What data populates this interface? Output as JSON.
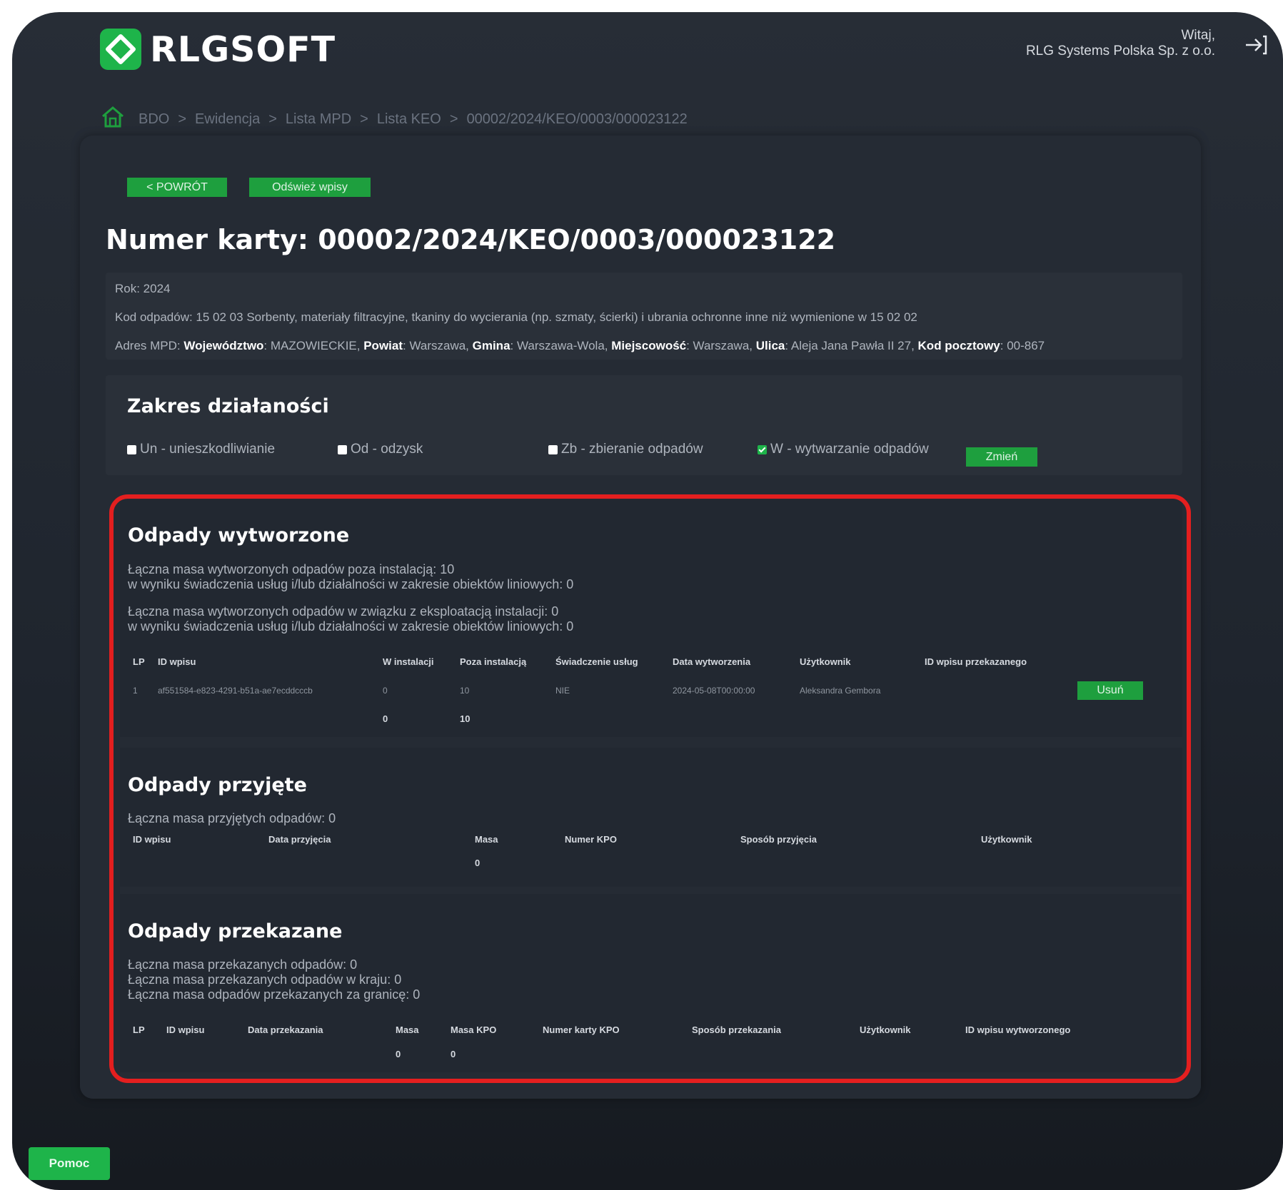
{
  "header": {
    "logo_text": "RLGSOFT",
    "welcome_line1": "Witaj,",
    "welcome_line2": "RLG Systems Polska Sp. z o.o."
  },
  "breadcrumb": {
    "items": [
      "BDO",
      "Ewidencja",
      "Lista MPD",
      "Lista KEO",
      "00002/2024/KEO/0003/000023122"
    ],
    "separator": ">"
  },
  "toolbar": {
    "back_label": "< POWRÓT",
    "refresh_label": "Odśwież wpisy"
  },
  "card": {
    "title": "Numer karty: 00002/2024/KEO/0003/000023122",
    "year_line": "Rok: 2024",
    "waste_code_line": "Kod odpadów: 15 02 03 Sorbenty, materiały filtracyjne, tkaniny do wycierania (np. szmaty, ścierki) i ubrania ochronne inne niż wymienione w 15 02 02",
    "address": {
      "prefix": "Adres MPD: ",
      "voivodeship_label": "Województwo",
      "voivodeship_value": ": MAZOWIECKIE, ",
      "county_label": "Powiat",
      "county_value": ": Warszawa, ",
      "commune_label": "Gmina",
      "commune_value": ": Warszawa-Wola, ",
      "locality_label": "Miejscowość",
      "locality_value": ": Warszawa, ",
      "street_label": "Ulica",
      "street_value": ": Aleja Jana Pawła II 27, ",
      "postcode_label": "Kod pocztowy",
      "postcode_value": ": 00-867"
    }
  },
  "scope": {
    "title": "Zakres działaności",
    "options": [
      {
        "label": "Un - unieszkodliwianie",
        "checked": false
      },
      {
        "label": "Od - odzysk",
        "checked": false
      },
      {
        "label": "Zb - zbieranie odpadów",
        "checked": false
      },
      {
        "label": "W - wytwarzanie odpadów",
        "checked": true
      }
    ],
    "change_label": "Zmień"
  },
  "generated": {
    "title": "Odpady wytworzone",
    "lines": [
      "Łączna masa wytworzonych odpadów poza instalacją: 10",
      "w wyniku świadczenia usług i/lub działalności w zakresie obiektów liniowych: 0",
      "Łączna masa wytworzonych odpadów w związku z eksploatacją instalacji: 0",
      "w wyniku świadczenia usług i/lub działalności w zakresie obiektów liniowych: 0"
    ],
    "columns": [
      "LP",
      "ID wpisu",
      "W instalacji",
      "Poza instalacją",
      "Świadczenie usług",
      "Data wytworzenia",
      "Użytkownik",
      "ID wpisu przekazanego"
    ],
    "rows": [
      [
        "1",
        "af551584-e823-4291-b51a-ae7ecddcccb",
        "0",
        "10",
        "NIE",
        "2024-05-08T00:00:00",
        "Aleksandra Gembora",
        ""
      ]
    ],
    "delete_label": "Usuń",
    "totals": [
      "0",
      "10"
    ]
  },
  "received": {
    "title": "Odpady przyjęte",
    "lines": [
      "Łączna masa przyjętych odpadów: 0"
    ],
    "columns": [
      "ID wpisu",
      "Data przyjęcia",
      "Masa",
      "Numer KPO",
      "Sposób przyjęcia",
      "Użytkownik"
    ],
    "totals": [
      "0"
    ]
  },
  "transferred": {
    "title": "Odpady przekazane",
    "lines": [
      "Łączna masa przekazanych odpadów: 0",
      "Łączna masa przekazanych odpadów w kraju: 0",
      "Łączna masa odpadów przekazanych za granicę: 0"
    ],
    "columns": [
      "LP",
      "ID wpisu",
      "Data przekazania",
      "Masa",
      "Masa KPO",
      "Numer karty KPO",
      "Sposób przekazania",
      "Użytkownik",
      "ID wpisu wytworzonego"
    ],
    "totals": [
      "0",
      "0"
    ]
  },
  "footer": {
    "help_label": "Pomoc"
  },
  "colors": {
    "accent_green": "#1eb44a",
    "button_green": "#1e9f3e",
    "highlight_red": "#e41f1f",
    "background": "#222831"
  },
  "icons": {
    "logo": "recycle-diamond-icon",
    "logout": "logout-arrow-icon",
    "home": "home-icon"
  }
}
